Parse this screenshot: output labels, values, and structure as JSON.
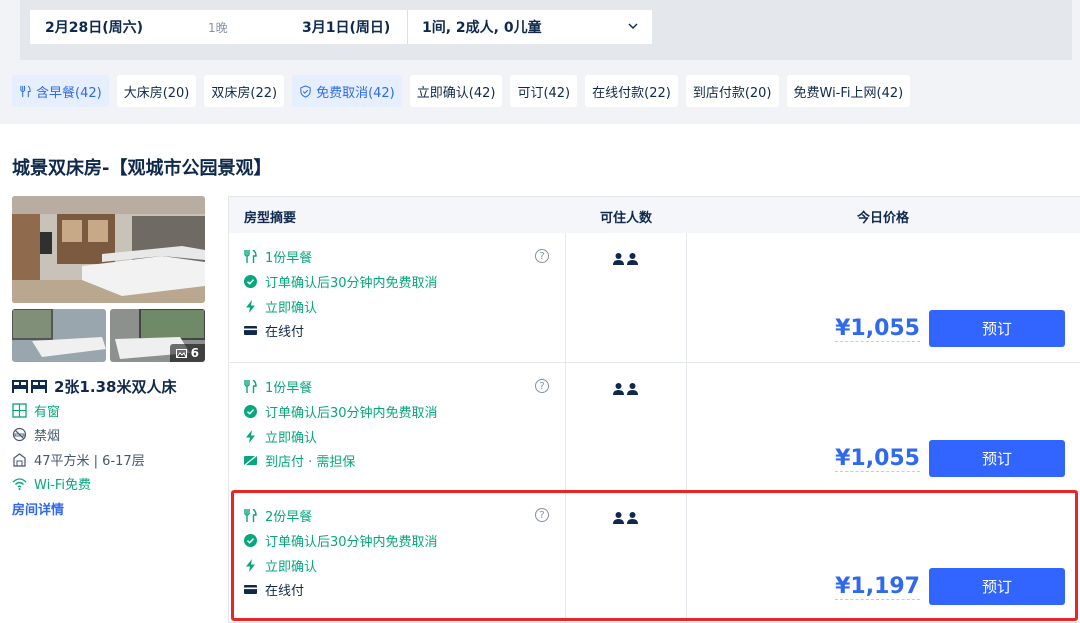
{
  "search": {
    "checkin": "2月28日(周六)",
    "nights": "1晚",
    "checkout": "3月1日(周日)",
    "guests": "1间, 2成人, 0儿童"
  },
  "filters": [
    {
      "label": "含早餐(42)",
      "icon": "utensils-icon",
      "active": true
    },
    {
      "label": "大床房(20)",
      "active": false
    },
    {
      "label": "双床房(22)",
      "active": false
    },
    {
      "label": "免费取消(42)",
      "icon": "shield-check-icon",
      "active": true
    },
    {
      "label": "立即确认(42)",
      "active": false
    },
    {
      "label": "可订(42)",
      "active": false
    },
    {
      "label": "在线付款(22)",
      "active": false
    },
    {
      "label": "到店付款(20)",
      "active": false
    },
    {
      "label": "免费Wi-Fi上网(42)",
      "active": false
    }
  ],
  "room": {
    "title": "城景双床房-【观城市公园景观】",
    "photo_count": "6",
    "bed": "2张1.38米双人床",
    "amenities": [
      {
        "label": "有窗",
        "icon": "window-icon"
      },
      {
        "label": "禁烟",
        "icon": "no-smoking-icon"
      },
      {
        "label": "47平方米 | 6-17层",
        "icon": "area-icon"
      },
      {
        "label": "Wi-Fi免费",
        "icon": "wifi-icon"
      }
    ],
    "detail_link": "房间详情"
  },
  "table": {
    "headers": {
      "summary": "房型摘要",
      "occupancy": "可住人数",
      "price": "今日价格"
    },
    "rows": [
      {
        "breakfast": "1份早餐",
        "cancel": "订单确认后30分钟内免费取消",
        "confirm": "立即确认",
        "payment": "在线付",
        "payment_icon": "card-icon",
        "price": "¥1,055",
        "book": "预订"
      },
      {
        "breakfast": "1份早餐",
        "cancel": "订单确认后30分钟内免费取消",
        "confirm": "立即确认",
        "payment": "到店付 · 需担保",
        "payment_icon": "pay-at-hotel-icon",
        "price": "¥1,055",
        "book": "预订"
      },
      {
        "breakfast": "2份早餐",
        "cancel": "订单确认后30分钟内免费取消",
        "confirm": "立即确认",
        "payment": "在线付",
        "payment_icon": "card-icon",
        "price": "¥1,197",
        "book": "预订"
      }
    ]
  },
  "colors": {
    "accent": "#2f6aee",
    "green": "#06a77d",
    "highlight": "#e8262a",
    "button": "#3264ff"
  }
}
